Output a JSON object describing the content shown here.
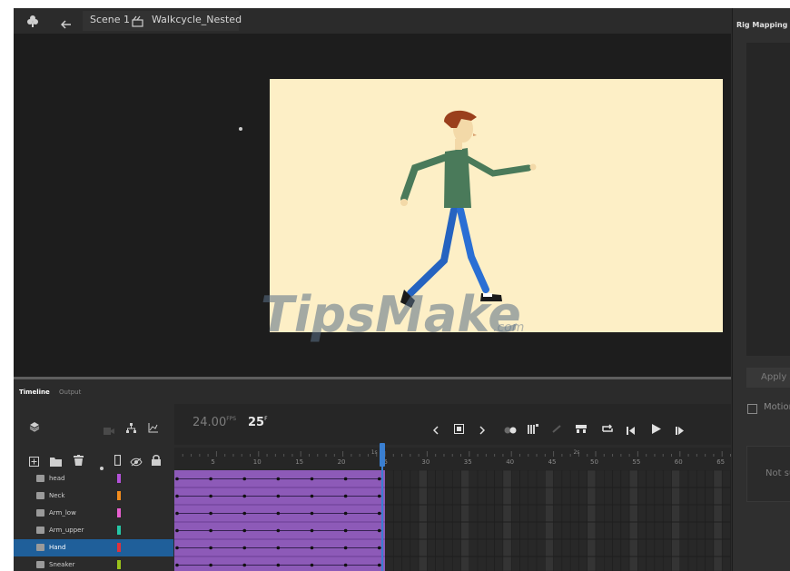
{
  "topbar": {
    "scene_label": "Scene 1",
    "symbol_label": "Walkcycle_Nested"
  },
  "rig_panel": {
    "title": "Rig Mapping",
    "apply_button": "Apply s",
    "motion_label": "Motion",
    "status_text": "Not su"
  },
  "timeline": {
    "tabs": [
      {
        "label": "Timeline"
      },
      {
        "label": "Output"
      }
    ],
    "fps_value": "24.00",
    "fps_unit": "FPS",
    "current_frame": "25",
    "current_frame_unit": "F",
    "ruler_numbers": [
      "5",
      "10",
      "15",
      "20",
      "25",
      "30",
      "35",
      "40",
      "45",
      "50",
      "55",
      "60",
      "65"
    ],
    "ruler_seconds": [
      "1s",
      "2s"
    ],
    "tween_end_frame": 25,
    "layers": [
      {
        "name": "head",
        "color": "#b452d9"
      },
      {
        "name": "Neck",
        "color": "#f28c1d"
      },
      {
        "name": "Arm_low",
        "color": "#e85fd0"
      },
      {
        "name": "Arm_upper",
        "color": "#25c7a6"
      },
      {
        "name": "Hand",
        "color": "#e0313b",
        "selected": true
      },
      {
        "name": "Sneaker",
        "color": "#9ac21b"
      }
    ]
  },
  "watermark": {
    "text": "TipsMake",
    "suffix": ".com"
  },
  "colors": {
    "stage": "#fdefc6",
    "tween": "#8d5ab8",
    "playhead": "#3a7fd1",
    "selected_layer": "#1f5f9a"
  }
}
